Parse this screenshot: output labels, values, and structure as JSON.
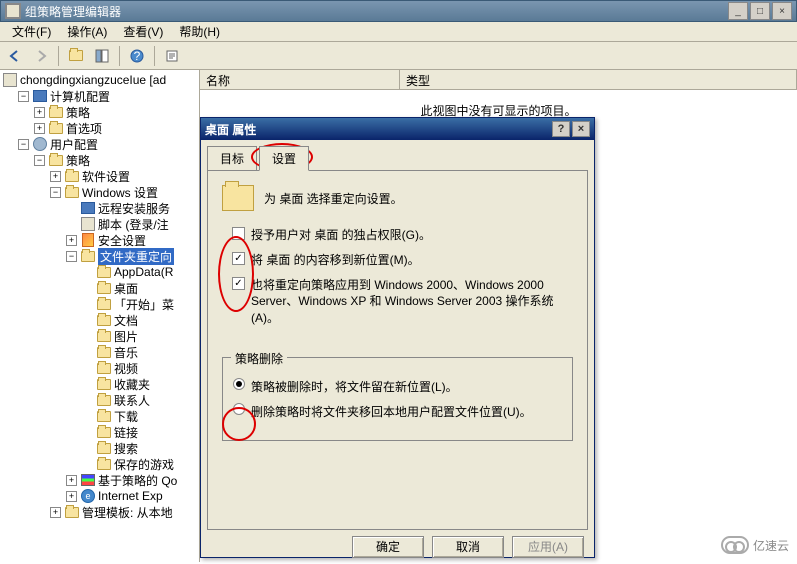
{
  "window": {
    "title": "组策略管理编辑器",
    "min_label": "_",
    "max_label": "□",
    "close_label": "×"
  },
  "menu": {
    "file": "文件(F)",
    "action": "操作(A)",
    "view": "查看(V)",
    "help": "帮助(H)"
  },
  "tree": {
    "root": "chongdingxiangzuceIue [ad",
    "computer_cfg": "计算机配置",
    "policies": "策略",
    "preferences": "首选项",
    "user_cfg": "用户配置",
    "policies2": "策略",
    "software_settings": "软件设置",
    "windows_settings": "Windows 设置",
    "remote_install": "远程安装服务",
    "scripts": "脚本 (登录/注",
    "security_settings": "安全设置",
    "folder_redirect": "文件夹重定向",
    "appdata": "AppData(R",
    "desktop": "桌面",
    "startmenu": "「开始」菜",
    "documents": "文档",
    "pictures": "图片",
    "music": "音乐",
    "videos": "视频",
    "favorites": "收藏夹",
    "contacts": "联系人",
    "downloads": "下载",
    "links": "链接",
    "searches": "搜索",
    "saved_games": "保存的游戏",
    "policy_qos": "基于策略的 Qo",
    "internet_exp": "Internet Exp",
    "admin_templates": "管理模板: 从本地",
    "truncated": ""
  },
  "list": {
    "col_name": "名称",
    "col_type": "类型",
    "empty_msg": "此视图中没有可显示的项目。"
  },
  "dialog": {
    "title": "桌面 属性",
    "help_label": "?",
    "close_label": "×",
    "tab_target": "目标",
    "tab_settings": "设置",
    "desc": "为 桌面 选择重定向设置。",
    "chk1": "授予用户对 桌面 的独占权限(G)。",
    "chk1_checked": false,
    "chk2": "将 桌面 的内容移到新位置(M)。",
    "chk2_checked": true,
    "chk3": "也将重定向策略应用到 Windows 2000、Windows 2000 Server、Windows XP 和 Windows Server 2003 操作系统(A)。",
    "chk3_checked": true,
    "group_label": "策略删除",
    "radio1": "策略被删除时，将文件留在新位置(L)。",
    "radio1_checked": true,
    "radio2": "删除策略时将文件夹移回本地用户配置文件位置(U)。",
    "radio2_checked": false,
    "btn_ok": "确定",
    "btn_cancel": "取消",
    "btn_apply": "应用(A)"
  },
  "watermark": "亿速云"
}
